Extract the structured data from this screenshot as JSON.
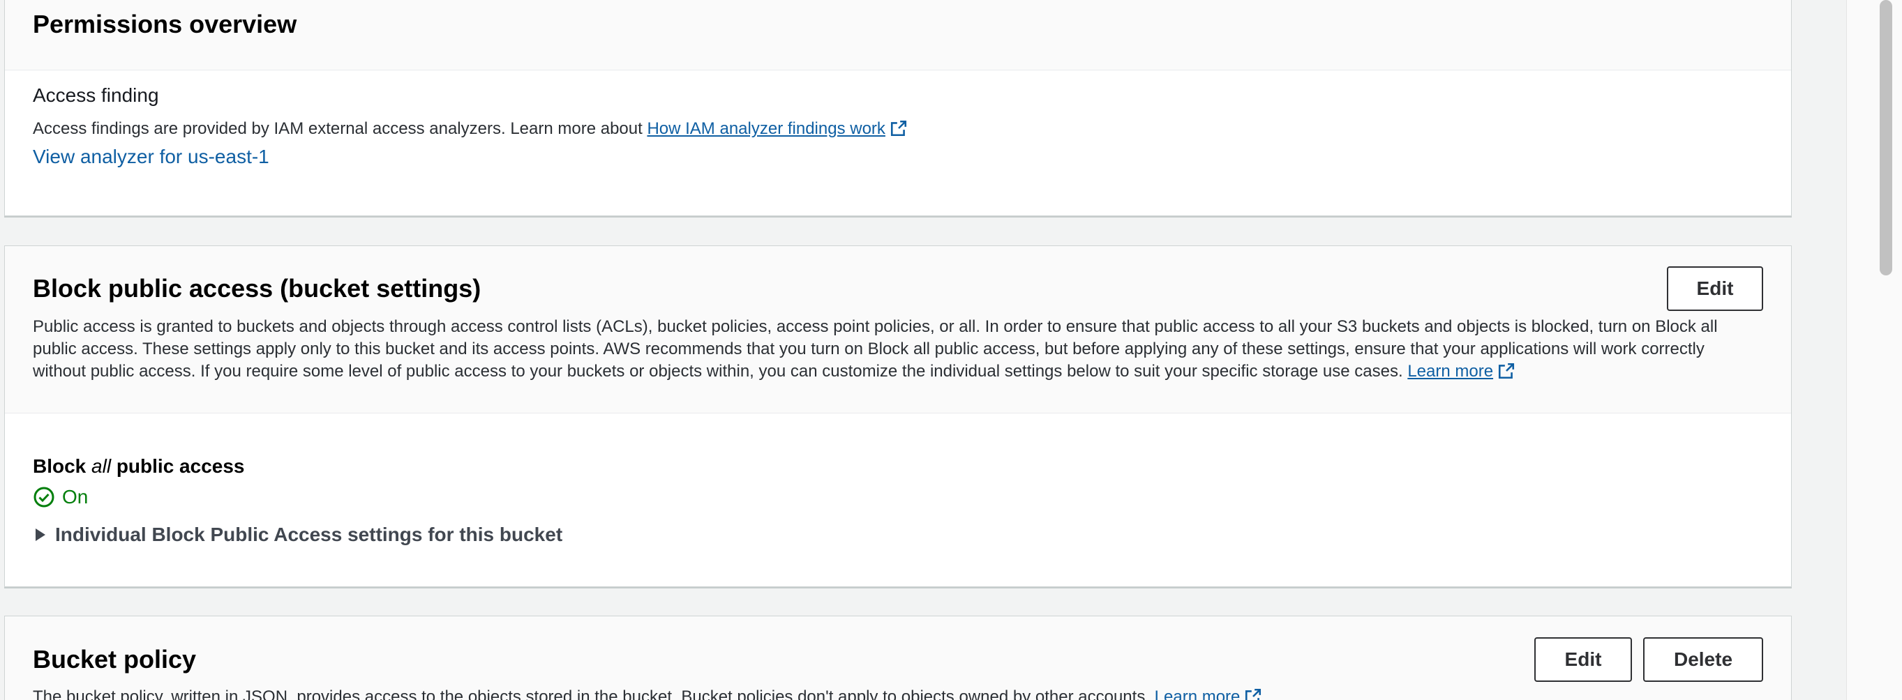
{
  "permissions_overview": {
    "title": "Permissions overview",
    "access_finding_label": "Access finding",
    "description": "Access findings are provided by IAM external access analyzers. Learn more about ",
    "help_link_text": "How IAM analyzer findings work",
    "analyzer_link_text": "View analyzer for us-east-1"
  },
  "block_public_access": {
    "title": "Block public access (bucket settings)",
    "edit_label": "Edit",
    "description": "Public access is granted to buckets and objects through access control lists (ACLs), bucket policies, access point policies, or all. In order to ensure that public access to all your S3 buckets and objects is blocked, turn on Block all public access. These settings apply only to this bucket and its access points. AWS recommends that you turn on Block all public access, but before applying any of these settings, ensure that your applications will work correctly without public access. If you require some level of public access to your buckets or objects within, you can customize the individual settings below to suit your specific storage use cases. ",
    "learn_more_text": "Learn more",
    "setting_label_prefix": "Block ",
    "setting_label_emphasis": "all",
    "setting_label_suffix": " public access",
    "status_text": "On",
    "status_icon": "check-circle-icon",
    "expand_label": "Individual Block Public Access settings for this bucket"
  },
  "bucket_policy": {
    "title": "Bucket policy",
    "edit_label": "Edit",
    "delete_label": "Delete",
    "description": "The bucket policy, written in JSON, provides access to the objects stored in the bucket. Bucket policies don't apply to objects owned by other accounts. ",
    "learn_more_text": "Learn more"
  },
  "colors": {
    "link": "#0f5fa3",
    "success": "#037f0c",
    "page_background": "#f2f3f3"
  }
}
